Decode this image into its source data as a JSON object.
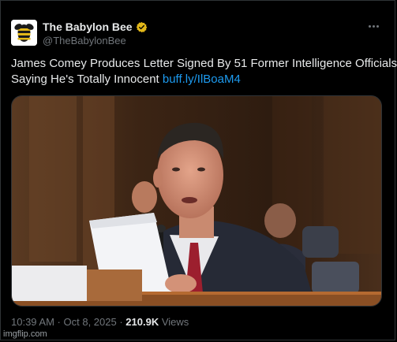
{
  "account": {
    "display_name": "The Babylon Bee",
    "handle": "@TheBabylonBee",
    "avatar_icon": "bee-logo-icon",
    "verified_color": "#e2b719"
  },
  "tweet": {
    "line1": "James Comey Produces Letter Signed By 51 Former Intelligence Officials",
    "line2": "Saying He's Totally Innocent",
    "link": "buff.ly/IlBoaM4"
  },
  "meta": {
    "time": "10:39 AM",
    "separator1": " · ",
    "date": "Oct 8, 2025",
    "separator2": " · ",
    "views_count": "210.9K",
    "views_label": " Views"
  },
  "watermark": "imgflip.com",
  "colors": {
    "background": "#000000",
    "text": "#e7e9ea",
    "muted": "#71767b",
    "link": "#1d9bf0",
    "border": "#2f3336"
  }
}
